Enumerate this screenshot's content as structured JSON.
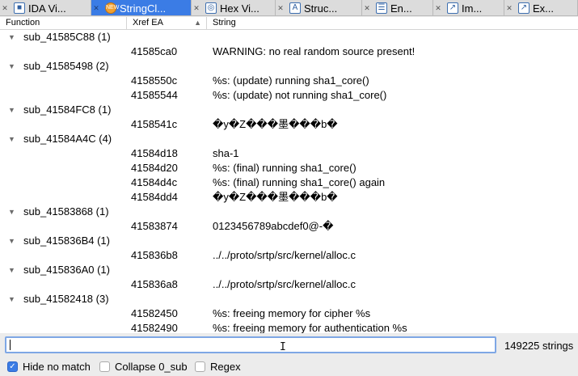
{
  "tabs": [
    {
      "label": "IDA Vi...",
      "icon": "ida-view-icon",
      "glyph": "■"
    },
    {
      "label": "StringCl...",
      "icon": "stringcluster-plugin-icon",
      "glyph": "NEW"
    },
    {
      "label": "Hex Vi...",
      "icon": "hex-view-icon",
      "glyph": "◎"
    },
    {
      "label": "Struc...",
      "icon": "structures-icon",
      "glyph": "A"
    },
    {
      "label": "En...",
      "icon": "enums-icon",
      "glyph": "☰"
    },
    {
      "label": "Im...",
      "icon": "imports-icon",
      "glyph": "↗"
    },
    {
      "label": "Ex...",
      "icon": "exports-icon",
      "glyph": "↗"
    }
  ],
  "columns": {
    "function": "Function",
    "xref": "Xref EA",
    "string": "String"
  },
  "rows": [
    {
      "type": "group",
      "name": "sub_41585C88 (1)"
    },
    {
      "type": "item",
      "xref": "41585ca0",
      "string": "WARNING: no real random source present!"
    },
    {
      "type": "group",
      "name": "sub_41585498 (2)"
    },
    {
      "type": "item",
      "xref": "4158550c",
      "string": "%s: (update) running sha1_core()"
    },
    {
      "type": "item",
      "xref": "41585544",
      "string": "%s: (update) not running sha1_core()"
    },
    {
      "type": "group",
      "name": "sub_41584FC8 (1)"
    },
    {
      "type": "item",
      "xref": "4158541c",
      "string": "�y�Z���墨���b�"
    },
    {
      "type": "group",
      "name": "sub_41584A4C (4)"
    },
    {
      "type": "item",
      "xref": "41584d18",
      "string": "sha-1"
    },
    {
      "type": "item",
      "xref": "41584d20",
      "string": "%s: (final) running sha1_core()"
    },
    {
      "type": "item",
      "xref": "41584d4c",
      "string": "%s: (final) running sha1_core() again"
    },
    {
      "type": "item",
      "xref": "41584dd4",
      "string": "�y�Z���墨���b�"
    },
    {
      "type": "group",
      "name": "sub_41583868 (1)"
    },
    {
      "type": "item",
      "xref": "41583874",
      "string": "0123456789abcdef0@-�"
    },
    {
      "type": "group",
      "name": "sub_415836B4 (1)"
    },
    {
      "type": "item",
      "xref": "415836b8",
      "string": "../../proto/srtp/src/kernel/alloc.c"
    },
    {
      "type": "group",
      "name": "sub_415836A0 (1)"
    },
    {
      "type": "item",
      "xref": "415836a8",
      "string": "../../proto/srtp/src/kernel/alloc.c"
    },
    {
      "type": "group",
      "name": "sub_41582418 (3)"
    },
    {
      "type": "item",
      "xref": "41582450",
      "string": "%s: freeing memory for cipher %s"
    },
    {
      "type": "item",
      "xref": "41582490",
      "string": "%s: freeing memory for authentication %s"
    }
  ],
  "search": {
    "value": "",
    "count_label": "149225 strings"
  },
  "options": [
    {
      "label": "Hide no match",
      "checked": true
    },
    {
      "label": "Collapse 0_sub",
      "checked": false
    },
    {
      "label": "Regex",
      "checked": false
    }
  ],
  "colors": {
    "active_tab": "#3b7ce5",
    "search_border": "#7ea7e5"
  }
}
